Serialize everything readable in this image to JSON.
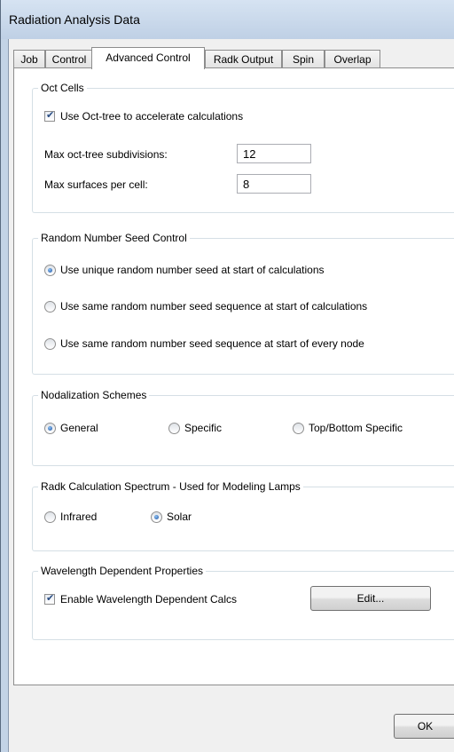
{
  "window": {
    "title": "Radiation Analysis Data"
  },
  "tabs": [
    {
      "label": "Job",
      "active": false
    },
    {
      "label": "Control",
      "active": false
    },
    {
      "label": "Advanced Control",
      "active": true
    },
    {
      "label": "Radk Output",
      "active": false
    },
    {
      "label": "Spin",
      "active": false
    },
    {
      "label": "Overlap",
      "active": false
    }
  ],
  "oct_cells": {
    "legend": "Oct Cells",
    "use_octtree": {
      "label": "Use Oct-tree to accelerate calculations",
      "checked": true
    },
    "max_subdivisions": {
      "label": "Max oct-tree subdivisions:",
      "value": "12"
    },
    "max_surfaces": {
      "label": "Max surfaces per cell:",
      "value": "8"
    }
  },
  "random_seed": {
    "legend": "Random Number Seed Control",
    "options": [
      {
        "label": "Use unique random number seed at start of calculations",
        "selected": true
      },
      {
        "label": "Use same random number seed sequence at start of calculations",
        "selected": false
      },
      {
        "label": "Use same random number seed sequence at start of every node",
        "selected": false
      }
    ]
  },
  "nodalization": {
    "legend": "Nodalization Schemes",
    "options": [
      {
        "label": "General",
        "selected": true
      },
      {
        "label": "Specific",
        "selected": false
      },
      {
        "label": "Top/Bottom Specific",
        "selected": false
      }
    ]
  },
  "spectrum": {
    "legend": "Radk Calculation Spectrum - Used for Modeling Lamps",
    "options": [
      {
        "label": "Infrared",
        "selected": false
      },
      {
        "label": "Solar",
        "selected": true
      }
    ]
  },
  "wavelength": {
    "legend": "Wavelength Dependent Properties",
    "enable": {
      "label": "Enable Wavelength Dependent Calcs",
      "checked": true
    },
    "edit_label": "Edit..."
  },
  "footer": {
    "ok_label": "OK"
  },
  "colors": {
    "window_frame": "#c3d3e6",
    "dialog_bg": "#f0f0f0",
    "radio_dot": "#1a4f9e",
    "check_mark": "#2a4d83"
  }
}
